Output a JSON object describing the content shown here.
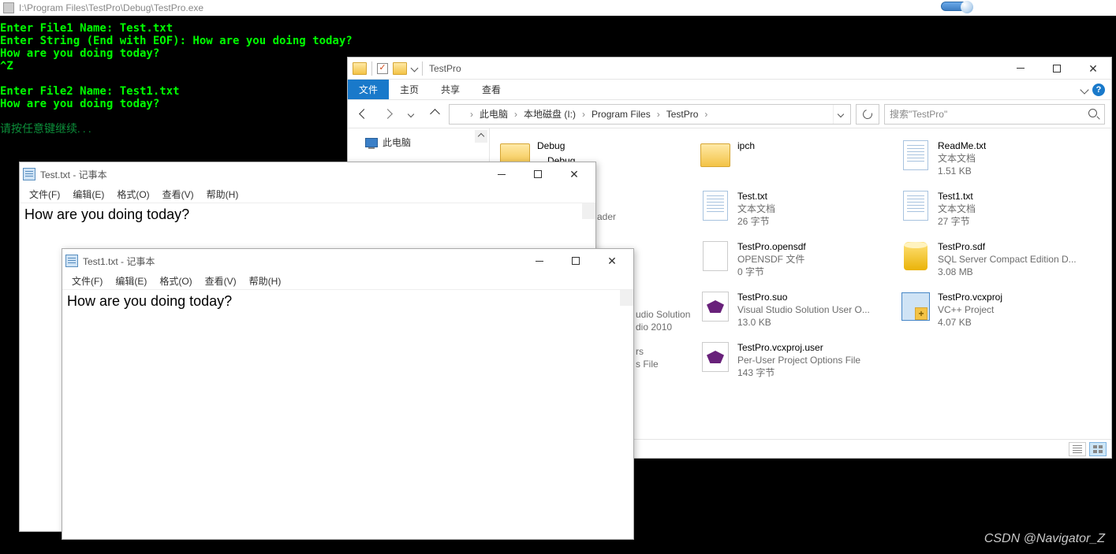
{
  "console": {
    "title": "I:\\Program Files\\TestPro\\Debug\\TestPro.exe",
    "lines": [
      "Enter File1 Name: Test.txt",
      "Enter String (End with EOF): How are you doing today?",
      "How are you doing today?",
      "^Z",
      "",
      "Enter File2 Name: Test1.txt",
      "How are you doing today?",
      ""
    ],
    "press_any_key": "请按任意键继续. . ."
  },
  "explorer": {
    "title_label": "TestPro",
    "tabs": {
      "file": "文件",
      "home": "主页",
      "share": "共享",
      "view": "查看"
    },
    "breadcrumbs": [
      "此电脑",
      "本地磁盘 (I:)",
      "Program Files",
      "TestPro"
    ],
    "search_placeholder": "搜索\"TestPro\"",
    "navpane": {
      "this_pc": "此电脑"
    },
    "peek": {
      "debug": "Debug",
      "ipch": "ipch",
      "header_frag": "ader",
      "sln_line1": "udio Solution",
      "sln_line2": "dio 2010",
      "filters_line1": "rs",
      "filters_line2": "s File"
    },
    "files": [
      {
        "icon": "folder",
        "name": "Debug",
        "type": "",
        "size": ""
      },
      {
        "icon": "folder",
        "name": "ipch",
        "type": "",
        "size": ""
      },
      {
        "icon": "text",
        "name": "ReadMe.txt",
        "type": "文本文档",
        "size": "1.51 KB"
      },
      {
        "icon": "text",
        "name": "Test.txt",
        "type": "文本文档",
        "size": "26 字节"
      },
      {
        "icon": "text",
        "name": "Test1.txt",
        "type": "文本文档",
        "size": "27 字节"
      },
      {
        "icon": "blank",
        "name": "TestPro.opensdf",
        "type": "OPENSDF 文件",
        "size": "0 字节"
      },
      {
        "icon": "db",
        "name": "TestPro.sdf",
        "type": "SQL Server Compact Edition D...",
        "size": "3.08 MB"
      },
      {
        "icon": "vs",
        "name": "TestPro.suo",
        "type": "Visual Studio Solution User O...",
        "size": "13.0 KB"
      },
      {
        "icon": "vcx",
        "name": "TestPro.vcxproj",
        "type": "VC++ Project",
        "size": "4.07 KB"
      },
      {
        "icon": "vs",
        "name": "TestPro.vcxproj.user",
        "type": "Per-User Project Options File",
        "size": "143 字节"
      }
    ]
  },
  "notepad1": {
    "title": "Test.txt - 记事本",
    "menu": {
      "file": "文件(F)",
      "edit": "编辑(E)",
      "format": "格式(O)",
      "view": "查看(V)",
      "help": "帮助(H)"
    },
    "content": "How are you doing today?"
  },
  "notepad2": {
    "title": "Test1.txt - 记事本",
    "menu": {
      "file": "文件(F)",
      "edit": "编辑(E)",
      "format": "格式(O)",
      "view": "查看(V)",
      "help": "帮助(H)"
    },
    "content": "How are you doing today?"
  },
  "watermark": "CSDN @Navigator_Z"
}
